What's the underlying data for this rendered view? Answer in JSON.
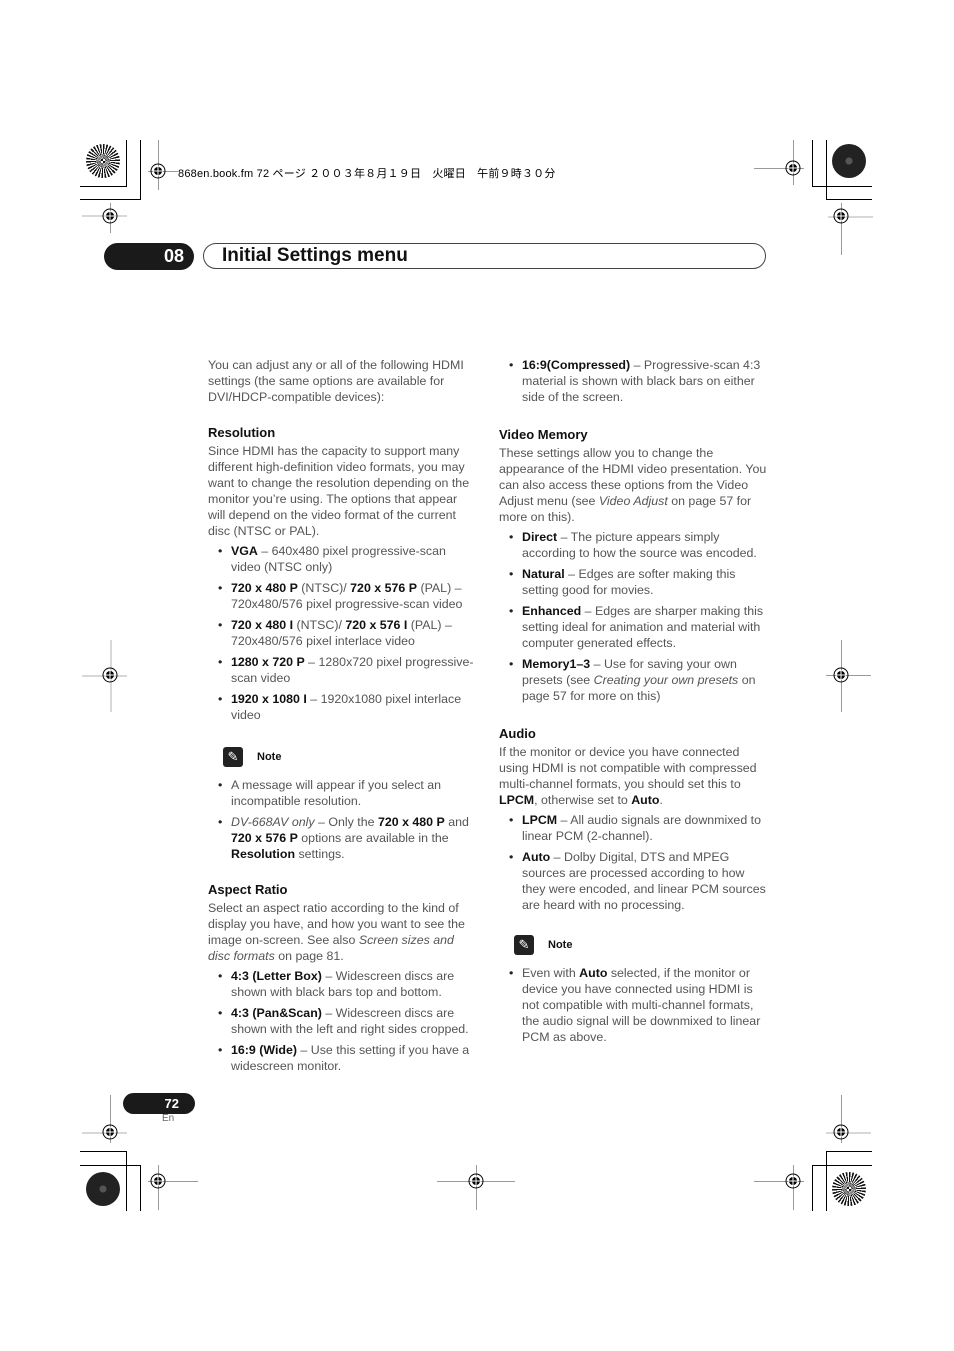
{
  "header": {
    "file_info": "868en.book.fm  72 ページ  ２００３年８月１９日　火曜日　午前９時３０分",
    "chapter_number": "08",
    "chapter_title": "Initial Settings menu"
  },
  "left_column": {
    "intro": "You can adjust any or all of the following HDMI settings (the same options are available for DVI/HDCP-compatible devices):",
    "resolution": {
      "heading": "Resolution",
      "body": "Since HDMI has the capacity to support many different high-definition video formats, you may want to change the resolution depending on the monitor you’re using.  The options that appear will depend on the video format of the current disc (NTSC or PAL).",
      "items": [
        {
          "term": "VGA",
          "text": " – 640x480 pixel progressive-scan video (NTSC only)"
        },
        {
          "term": "720 x 480 P",
          "mid": " (NTSC)/ ",
          "term2": "720 x 576 P",
          "text": " (PAL) – 720x480/576 pixel progressive-scan video"
        },
        {
          "term": "720 x 480 I",
          "mid": " (NTSC)/ ",
          "term2": "720 x 576 I",
          "text": " (PAL) – 720x480/576 pixel interlace video"
        },
        {
          "term": "1280 x 720 P",
          "text": " – 1280x720 pixel progressive-scan video"
        },
        {
          "term": "1920 x 1080 I",
          "text": " – 1920x1080 pixel interlace video"
        }
      ]
    },
    "note": {
      "label": "Note",
      "item1": "A message will appear if you select an incompatible resolution.",
      "item2_italic": "DV-668AV only",
      "item2_a": " – Only the ",
      "item2_b1": "720 x 480 P",
      "item2_c": " and ",
      "item2_b2": "720 x 576 P",
      "item2_d": " options are available in the ",
      "item2_b3": "Resolution",
      "item2_e": " settings."
    },
    "aspect_ratio": {
      "heading": "Aspect Ratio",
      "body_a": "Select an aspect ratio according to the kind of display you have, and how you want to see the image on-screen. See also ",
      "body_italic": "Screen sizes and disc formats",
      "body_b": " on page 81.",
      "items": [
        {
          "term": "4:3 (Letter Box)",
          "text": " – Widescreen discs are shown with black bars top and bottom."
        },
        {
          "term": "4:3 (Pan&Scan)",
          "text": " – Widescreen discs are shown with the left and right sides cropped."
        },
        {
          "term": "16:9 (Wide)",
          "text": " – Use this setting if you have a widescreen monitor."
        }
      ]
    }
  },
  "right_column": {
    "compressed_item": {
      "term": "16:9(Compressed)",
      "text": " – Progressive-scan 4:3 material is shown with black bars on either side of the screen."
    },
    "video_memory": {
      "heading": "Video Memory",
      "body_a": "These settings allow you to change the appearance of the HDMI video presentation. You can also access these options from the Video Adjust menu (see ",
      "body_italic": "Video Adjust",
      "body_b": " on page 57 for more on this).",
      "items": [
        {
          "term": "Direct",
          "text": " – The picture appears simply according to how the source was encoded."
        },
        {
          "term": "Natural",
          "text": " – Edges are softer making this setting good for movies."
        },
        {
          "term": "Enhanced",
          "text": " – Edges are sharper making this setting ideal for animation and material with computer generated effects."
        }
      ],
      "memory_item": {
        "term": "Memory1–3",
        "text_a": " – Use for saving your own presets (see ",
        "italic": "Creating your own presets",
        "text_b": " on page 57 for more on this)"
      }
    },
    "audio": {
      "heading": "Audio",
      "body_a": "If the monitor or device you have connected using HDMI is not compatible with compressed multi-channel formats, you should set this to ",
      "body_b1": "LPCM",
      "body_c": ", otherwise set to ",
      "body_b2": "Auto",
      "body_d": ".",
      "items": [
        {
          "term": "LPCM",
          "text": " – All audio signals are downmixed to linear PCM (2-channel)."
        },
        {
          "term": "Auto",
          "text": " – Dolby Digital, DTS and MPEG sources are processed according to how they were encoded, and linear PCM sources are heard with no processing."
        }
      ]
    },
    "note": {
      "label": "Note",
      "item_a": "Even with ",
      "item_b": "Auto",
      "item_c": " selected, if the monitor or device you have connected using HDMI is not compatible with multi-channel formats, the audio signal will be downmixed to linear PCM as above."
    }
  },
  "footer": {
    "page_number": "72",
    "language": "En"
  }
}
